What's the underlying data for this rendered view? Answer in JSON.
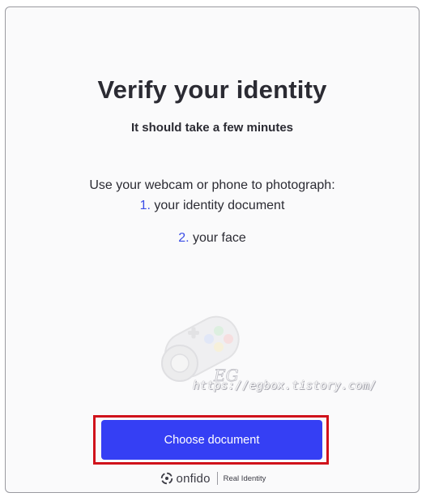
{
  "header": {
    "title": "Verify your identity",
    "subtitle": "It should take a few minutes"
  },
  "instructions": {
    "intro": "Use your webcam or phone to photograph:",
    "steps": [
      {
        "number": "1.",
        "text": "your identity document"
      },
      {
        "number": "2.",
        "text": "your face"
      }
    ]
  },
  "watermark": {
    "initials": "EG",
    "url": "https://egbox.tistory.com/",
    "icon": "gamepad-icon"
  },
  "actions": {
    "primary_label": "Choose document"
  },
  "footer": {
    "brand": "onfido",
    "tagline": "Real Identity",
    "icon": "onfido-logo-icon"
  },
  "colors": {
    "accent": "#353ff4",
    "step_number": "#3c4ee6",
    "highlight": "#d0121b",
    "text": "#2b2b33"
  }
}
